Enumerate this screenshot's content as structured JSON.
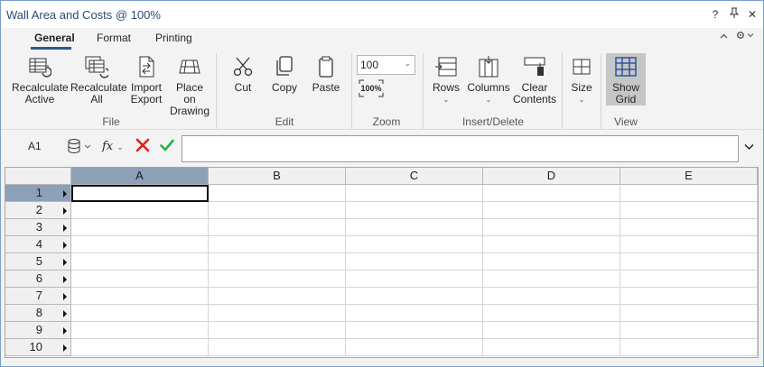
{
  "window": {
    "title": "Wall Area and Costs @ 100%",
    "help_label": "?",
    "pin_label": "⇟",
    "close_label": "✕"
  },
  "ribbon": {
    "tabs": [
      {
        "label": "General",
        "active": true
      },
      {
        "label": "Format",
        "active": false
      },
      {
        "label": "Printing",
        "active": false
      }
    ],
    "collapse_label": "^",
    "settings_label": "⚙⌄",
    "groups": {
      "file": {
        "label": "File",
        "recalc_active": "Recalculate Active",
        "recalc_all": "Recalculate All",
        "import_export": "Import Export",
        "place_on_drawing": "Place on Drawing"
      },
      "edit": {
        "label": "Edit",
        "cut": "Cut",
        "copy": "Copy",
        "paste": "Paste"
      },
      "zoom": {
        "label": "Zoom",
        "value": "100",
        "reset_label": "100%"
      },
      "insert_delete": {
        "label": "Insert/Delete",
        "rows": "Rows",
        "columns": "Columns",
        "clear": "Clear Contents"
      },
      "size": {
        "label": "Size"
      },
      "view": {
        "label": "View",
        "show_grid": "Show Grid"
      }
    }
  },
  "formula_bar": {
    "cell_ref": "A1",
    "fx_label": "fx",
    "value": ""
  },
  "grid": {
    "columns": [
      "A",
      "B",
      "C",
      "D",
      "E"
    ],
    "rows": [
      "1",
      "2",
      "3",
      "4",
      "5",
      "6",
      "7",
      "8",
      "9",
      "10"
    ],
    "selected_column": "A",
    "selected_row": "1"
  },
  "colors": {
    "accent": "#2b579a",
    "selection_header": "#8ca1b8",
    "cancel": "#e02020",
    "confirm": "#22b14c"
  }
}
